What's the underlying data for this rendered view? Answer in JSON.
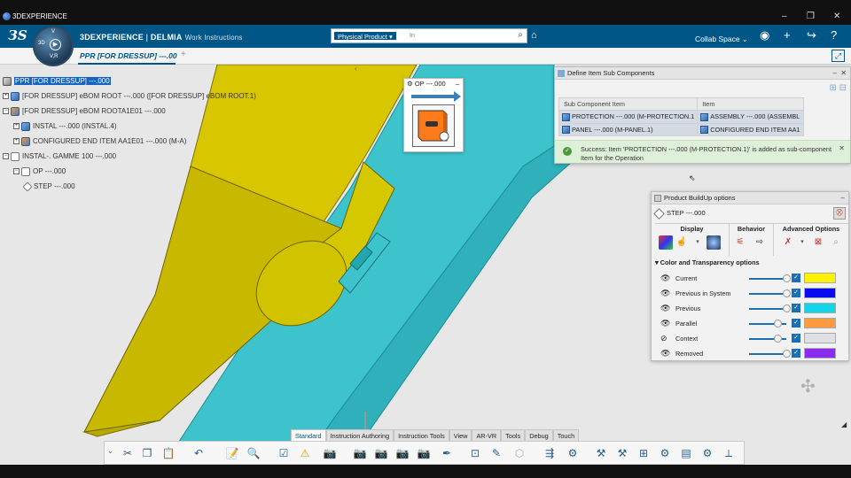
{
  "window": {
    "title": "3DEXPERIENCE",
    "controls": [
      "–",
      "❐",
      "✕"
    ]
  },
  "header": {
    "brand_prefix": "3DEXPERIENCE",
    "brand_sep": " | ",
    "brand_app": "DELMIA",
    "app_name": "Work Instructions",
    "search_scope": "Physical Product",
    "search_placeholder": "In",
    "collab_space": "Collab Space",
    "compass_v": "V",
    "compass_r": "V,R",
    "compass_3d": "3D"
  },
  "tab": {
    "label": "PPR [FOR DRESSUP] ---.00"
  },
  "tree": [
    {
      "label": "PPR [FOR DRESSUP] ---.000",
      "selected": true
    },
    {
      "label": "[FOR DRESSUP] eBOM ROOT ---.000 ([FOR DRESSUP] eBOM ROOT.1)"
    },
    {
      "label": "[FOR DRESSUP] eBOM ROOTA1E01 ---.000"
    },
    {
      "label": "INSTAL ---.000 (INSTAL.4)"
    },
    {
      "label": "CONFIGURED END ITEM AA1E01 ---.000 (M-A)"
    },
    {
      "label": "INSTAL-. GAMME 100 ---.000"
    },
    {
      "label": "OP ---.000"
    },
    {
      "label": "STEP ---.000"
    }
  ],
  "op_preview": {
    "title": "OP ---.000",
    "min": "–"
  },
  "define_panel": {
    "title": "Define Item Sub Components",
    "columns": [
      "Sub Component Item",
      "Item"
    ],
    "rows": [
      [
        "PROTECTION ---.000 (M-PROTECTION.1",
        "ASSEMBLY ---.000 (ASSEMBL"
      ],
      [
        "PANEL ---.000 (M-PANEL.1)",
        "CONFIGURED END ITEM AA1"
      ]
    ],
    "message": "Success: Item 'PROTECTION ---.000 (M-PROTECTION.1)' is added as sub-component Item for the Operation"
  },
  "buildup": {
    "title": "Product BuildUp options",
    "step": "STEP ---.000",
    "groups": [
      "Display",
      "Behavior",
      "Advanced Options"
    ],
    "section": "Color and Transparency options",
    "rows": [
      {
        "label": "Current",
        "color": "#fff200",
        "level": 1.0
      },
      {
        "label": "Previous in System",
        "color": "#0a0af0",
        "level": 1.0
      },
      {
        "label": "Previous",
        "color": "#11d6ea",
        "level": 1.0
      },
      {
        "label": "Parallel",
        "color": "#ff9a40",
        "level": 0.75
      },
      {
        "label": "Context",
        "color": "#e0e0e6",
        "level": 0.75
      },
      {
        "label": "Removed",
        "color": "#8a2cf0",
        "level": 1.0
      }
    ]
  },
  "action_tabs": [
    "Standard",
    "Instruction Authoring",
    "Instruction Tools",
    "View",
    "AR-VR",
    "Tools",
    "Debug",
    "Touch"
  ],
  "colors": {
    "brand": "#005686",
    "cyan_part": "#3cc3cc",
    "yellow_part": "#d4c400"
  }
}
